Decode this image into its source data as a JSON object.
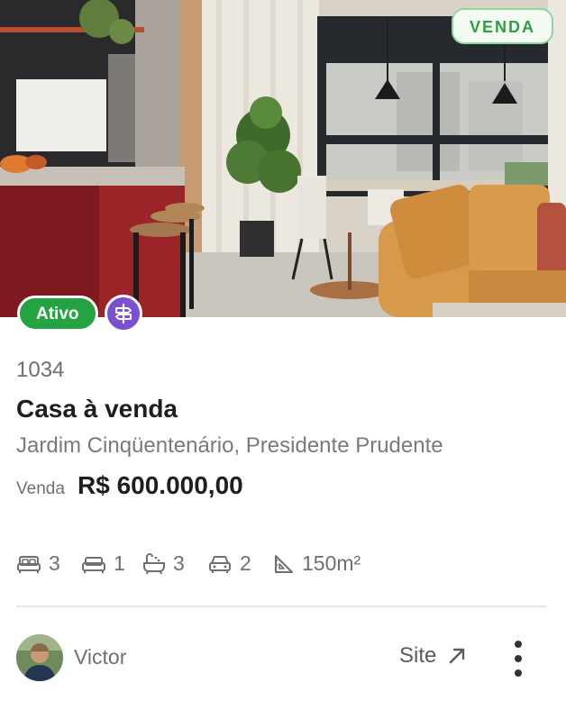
{
  "listing": {
    "deal_badge": "VENDA",
    "status_badge": "Ativo",
    "code": "1034",
    "title": "Casa à venda",
    "location": "Jardim Cinqüentenário, Presidente Prudente",
    "price_label": "Venda",
    "price": "R$ 600.000,00"
  },
  "features": [
    {
      "icon": "bed-icon",
      "value": "3"
    },
    {
      "icon": "sofa-icon",
      "value": "1"
    },
    {
      "icon": "bathtub-icon",
      "value": "3"
    },
    {
      "icon": "car-icon",
      "value": "2"
    },
    {
      "icon": "area-icon",
      "value": "150m²"
    }
  ],
  "footer": {
    "agent_name": "Victor",
    "site_label": "Site"
  },
  "colors": {
    "status_green": "#25a343",
    "deal_badge_green": "#2e9e45",
    "sign_badge_purple": "#7d4fd3"
  }
}
